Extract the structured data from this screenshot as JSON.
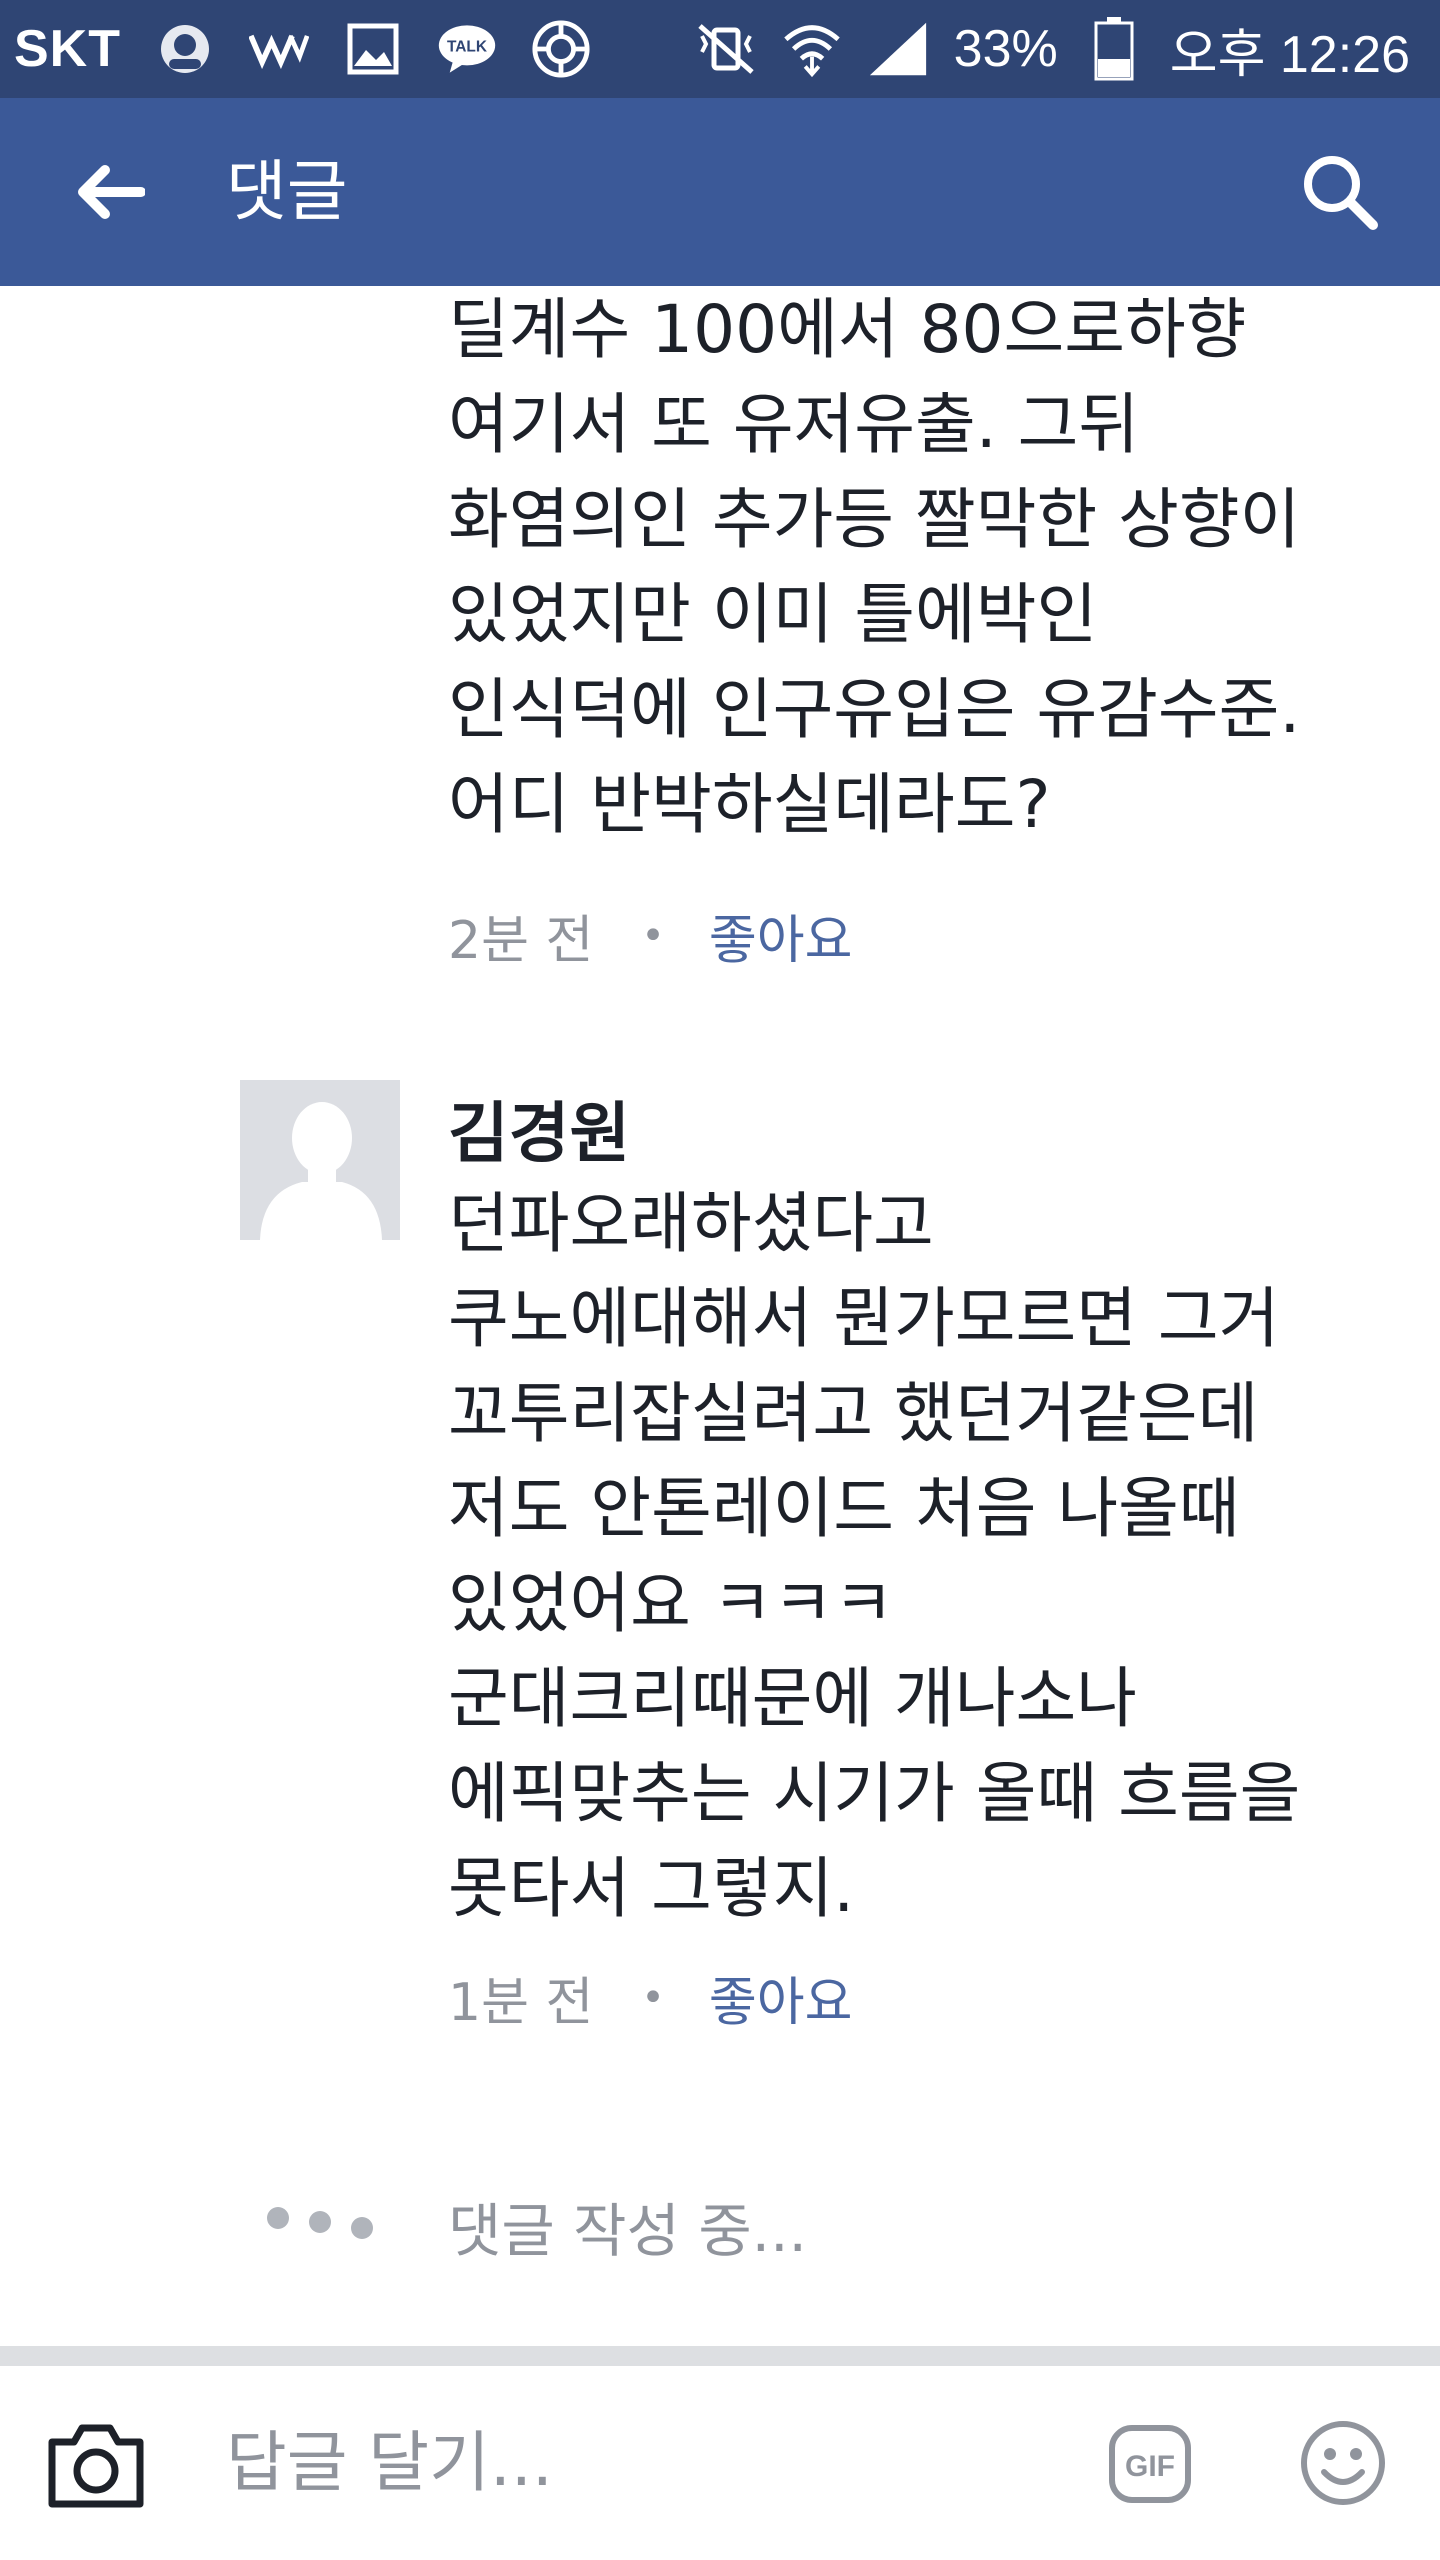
{
  "status_bar": {
    "carrier": "SKT",
    "battery": "33%",
    "time": "오후 12:26",
    "icons": [
      "avatar-icon",
      "w-app-icon",
      "gallery-icon",
      "talk-icon",
      "target-icon",
      "mute-icon",
      "wifi-icon",
      "signal-icon",
      "battery-icon"
    ]
  },
  "app_bar": {
    "title": "댓글"
  },
  "comments": [
    {
      "lines": [
        "딜계수 100에서 80으로하향",
        "여기서 또 유저유출. 그뒤",
        "화염의인 추가등 짤막한 상향이",
        "있었지만 이미 틀에박인",
        "인식덕에 인구유입은 유감수준.",
        "어디 반박하실데라도?"
      ],
      "time": "2분 전",
      "like_label": "좋아요"
    },
    {
      "author": "김경원",
      "lines": [
        "던파오래하셨다고",
        "쿠노에대해서 뭔가모르면 그거",
        "꼬투리잡실려고 했던거같은데",
        "저도 안톤레이드 처음 나올때",
        "있었어요 ㅋㅋㅋ",
        "군대크리때문에 개나소나",
        "에픽맞추는 시기가 올때 흐름을",
        "못타서 그렇지."
      ],
      "time": "1분 전",
      "like_label": "좋아요"
    }
  ],
  "typing_indicator": "댓글 작성 중...",
  "composer": {
    "placeholder": "답글 달기...",
    "gif_label": "GIF"
  },
  "colors": {
    "status_bar": "#2f4574",
    "app_bar": "#3b5998",
    "link": "#4b67a1",
    "meta": "#90949c",
    "text": "#1d2129"
  }
}
